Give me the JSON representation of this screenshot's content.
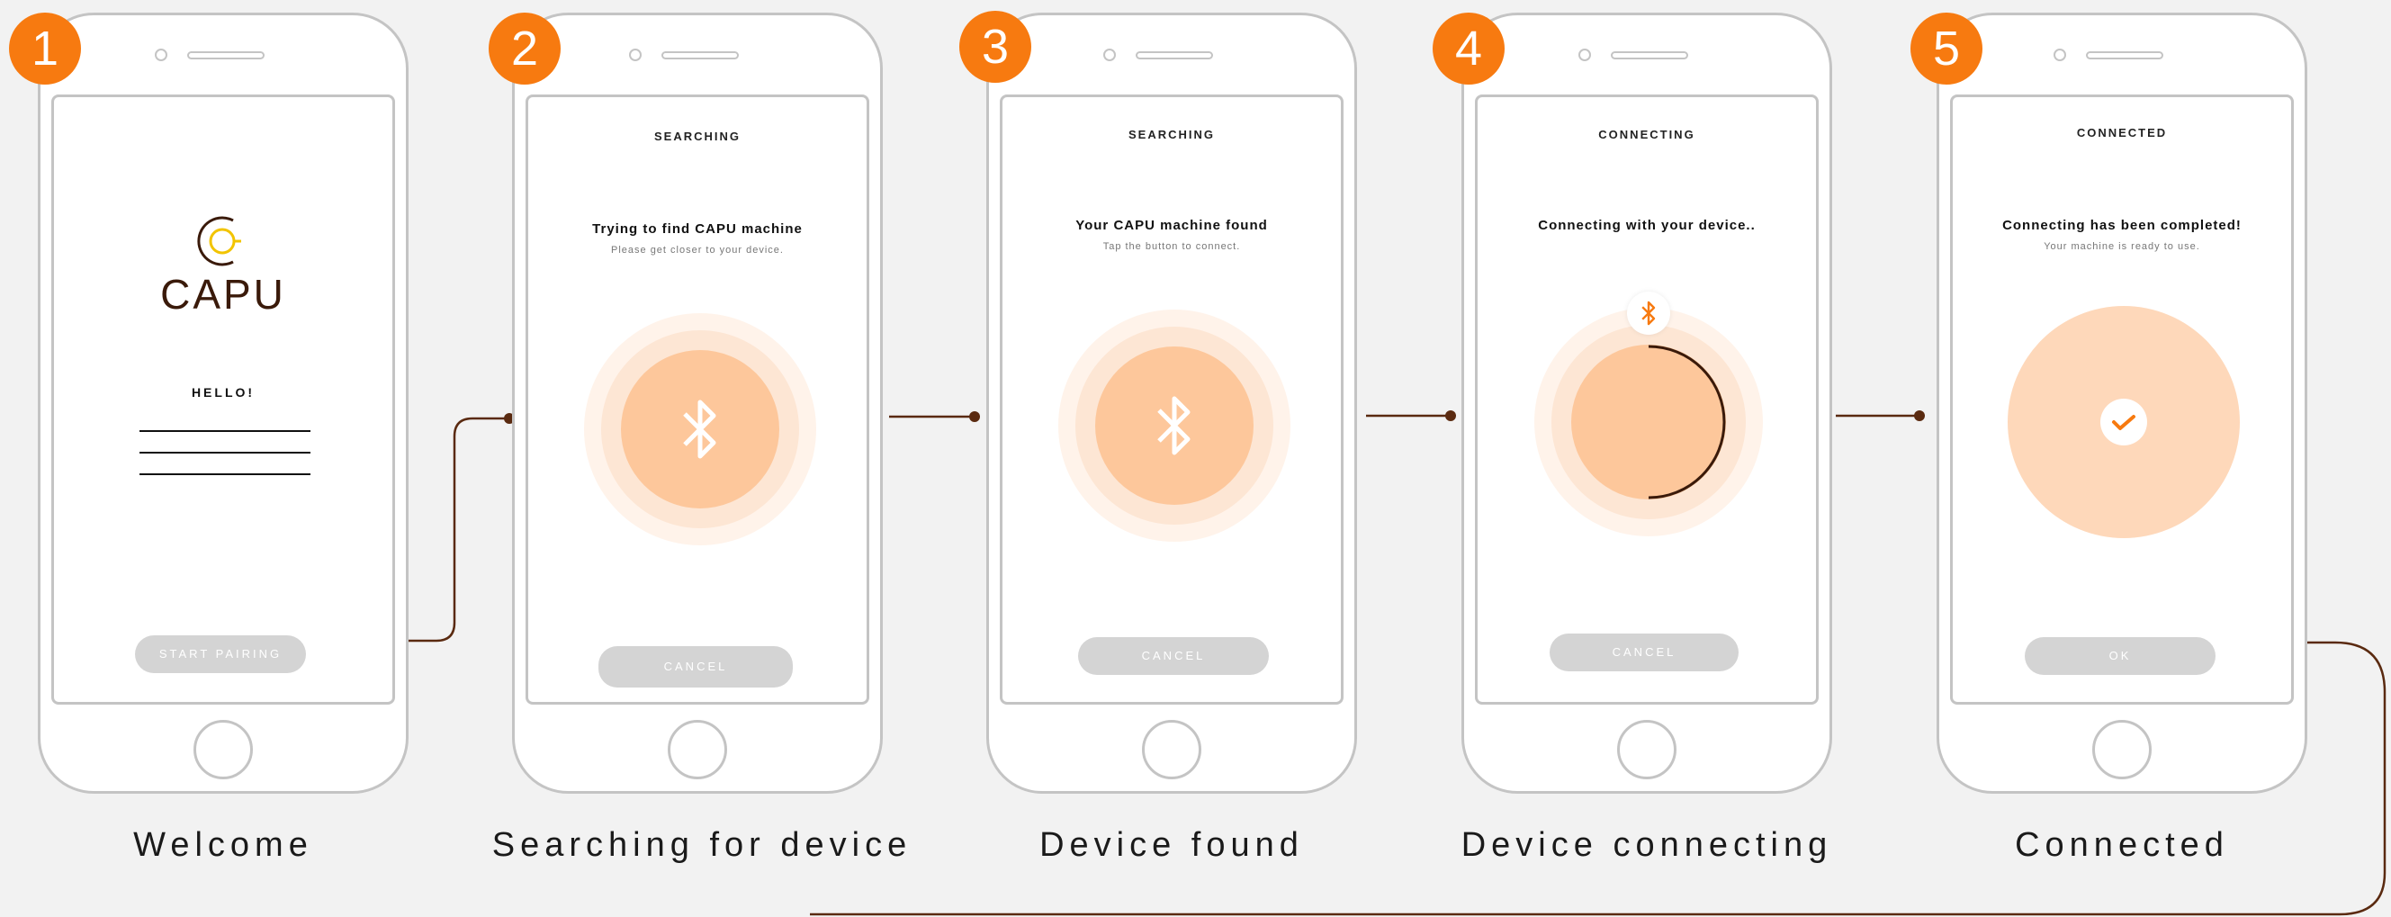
{
  "colors": {
    "accent": "#f77a10",
    "peach": "#fec99e",
    "peach_light": "#fde0c9",
    "connector": "#5a2a10"
  },
  "steps": [
    {
      "number": "1",
      "logo_text": "CAPU",
      "greeting": "HELLO!",
      "button": "START PAIRING",
      "caption": "Welcome"
    },
    {
      "number": "2",
      "title": "SEARCHING",
      "heading": "Trying to find CAPU machine",
      "sub": "Please get closer to your device.",
      "icon": "bluetooth-icon",
      "button": "CANCEL",
      "caption": "Searching for device"
    },
    {
      "number": "3",
      "title": "SEARCHING",
      "heading": "Your CAPU machine found",
      "sub": "Tap the button to connect.",
      "icon": "bluetooth-icon",
      "button": "CANCEL",
      "caption": "Device found"
    },
    {
      "number": "4",
      "title": "CONNECTING",
      "heading": "Connecting with your device..",
      "icon": "bluetooth-icon",
      "button": "CANCEL",
      "caption": "Device connecting"
    },
    {
      "number": "5",
      "title": "CONNECTED",
      "heading": "Connecting has been completed!",
      "sub": "Your machine is ready to use.",
      "icon": "checkmark-icon",
      "button": "OK",
      "caption": "Connected"
    }
  ]
}
